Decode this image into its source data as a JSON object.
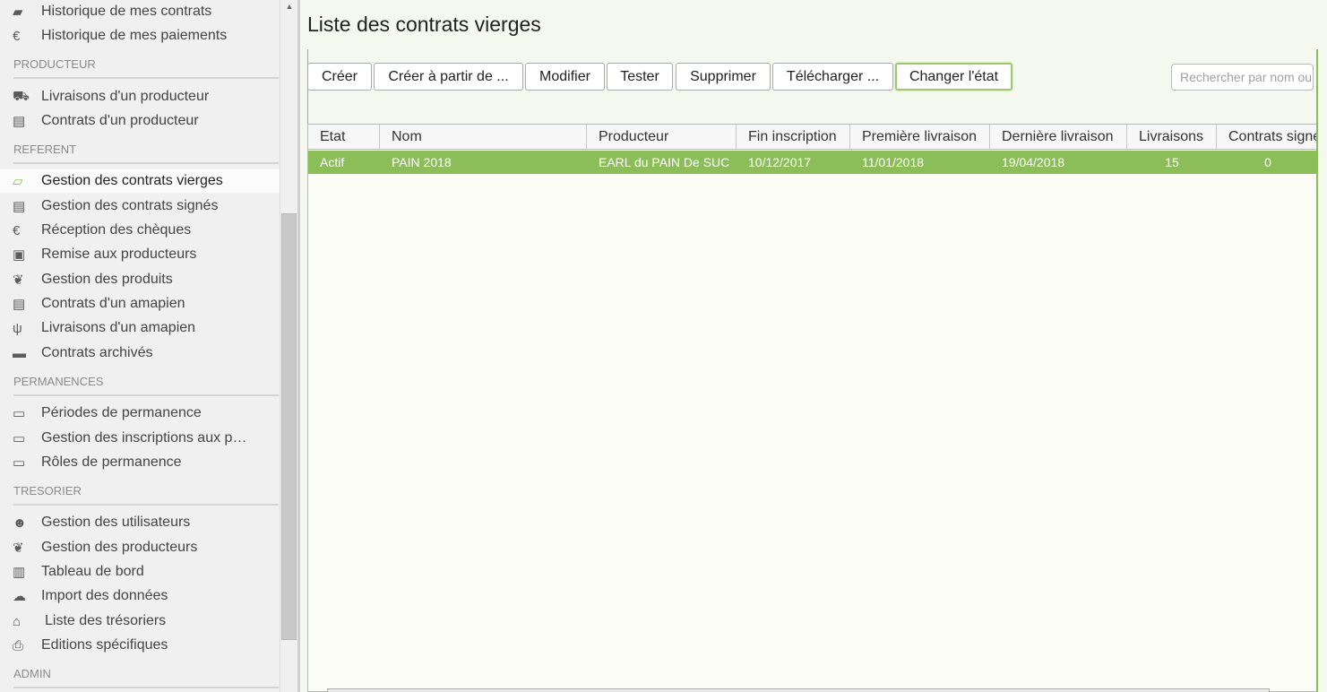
{
  "sidebar": {
    "items": [
      {
        "label": "Historique de mes contrats",
        "icon": "book-icon",
        "glyph": "▰"
      },
      {
        "label": "Historique de mes paiements",
        "icon": "euro-icon",
        "glyph": "€"
      },
      {
        "label": "Livraisons d'un producteur",
        "icon": "truck-icon",
        "glyph": "⛟"
      },
      {
        "label": "Contrats d'un producteur",
        "icon": "document-icon",
        "glyph": "▤"
      },
      {
        "label": "Gestion des contrats vierges",
        "icon": "folder-open-icon",
        "glyph": "▱"
      },
      {
        "label": "Gestion des contrats signés",
        "icon": "document-icon",
        "glyph": "▤"
      },
      {
        "label": "Réception des chèques",
        "icon": "euro-icon",
        "glyph": "€"
      },
      {
        "label": "Remise aux producteurs",
        "icon": "money-icon",
        "glyph": "▣"
      },
      {
        "label": "Gestion des produits",
        "icon": "leaf-icon",
        "glyph": "❦"
      },
      {
        "label": "Contrats d'un amapien",
        "icon": "document-icon",
        "glyph": "▤"
      },
      {
        "label": "Livraisons d'un amapien",
        "icon": "cutlery-icon",
        "glyph": "ψ"
      },
      {
        "label": "Contrats archivés",
        "icon": "archive-icon",
        "glyph": "▬"
      },
      {
        "label": "Périodes de permanence",
        "icon": "calendar-icon",
        "glyph": "▭"
      },
      {
        "label": "Gestion des inscriptions aux permanences",
        "icon": "calendar-icon",
        "glyph": "▭"
      },
      {
        "label": "Rôles de permanence",
        "icon": "calendar-icon",
        "glyph": "▭"
      },
      {
        "label": "Gestion des utilisateurs",
        "icon": "users-icon",
        "glyph": "☻"
      },
      {
        "label": "Gestion des producteurs",
        "icon": "leaf-icon",
        "glyph": "❦"
      },
      {
        "label": "Tableau de bord",
        "icon": "bar-chart-icon",
        "glyph": "▥"
      },
      {
        "label": "Import des données",
        "icon": "cloud-download-icon",
        "glyph": "☁"
      },
      {
        "label": "Liste des trésoriers",
        "icon": "graduation-cap-icon",
        "glyph": "⌂"
      },
      {
        "label": "Editions spécifiques",
        "icon": "print-icon",
        "glyph": "⎙"
      }
    ],
    "sections": {
      "producteur": "PRODUCTEUR",
      "referent": "REFERENT",
      "permanences": "PERMANENCES",
      "tresorier": "TRESORIER",
      "admin": "ADMIN"
    }
  },
  "main": {
    "title": "Liste des contrats vierges",
    "toolbar": {
      "create": "Créer",
      "create_from": "Créer à partir de ...",
      "modify": "Modifier",
      "test": "Tester",
      "delete": "Supprimer",
      "download": "Télécharger ...",
      "change_state": "Changer l'état"
    },
    "search_placeholder": "Rechercher par nom ou producteur",
    "table": {
      "columns": [
        "Etat",
        "Nom",
        "Producteur",
        "Fin inscription",
        "Première livraison",
        "Dernière livraison",
        "Livraisons",
        "Contrats signés"
      ],
      "rows": [
        [
          "Actif",
          "PAIN 2018",
          "EARL du PAIN De SUC",
          "10/12/2017",
          "11/01/2018",
          "19/04/2018",
          "15",
          "0"
        ]
      ]
    }
  },
  "colors": {
    "accent": "#8bbd58",
    "selected_row": "#8bbd58",
    "background": "#f4f8ef"
  }
}
